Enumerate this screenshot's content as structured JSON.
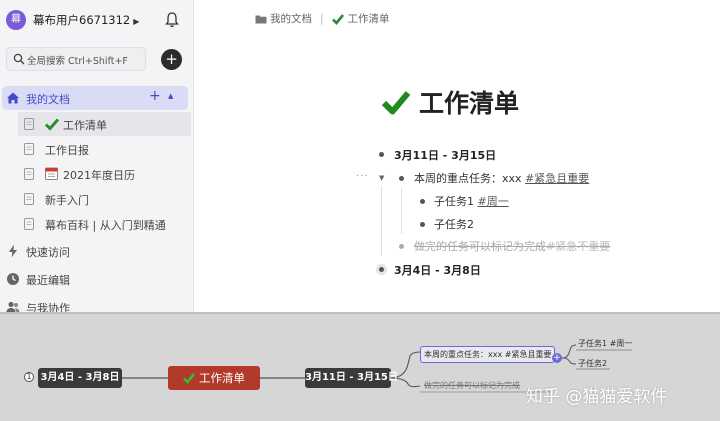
{
  "user": {
    "avatar_text": "幕",
    "name": "幕布用户6671312"
  },
  "search": {
    "placeholder": "全局搜索 Ctrl+Shift+F"
  },
  "sidebar": {
    "my_docs": "我的文档",
    "docs": [
      {
        "label": "工作清单",
        "icon": "check-emoji"
      },
      {
        "label": "工作日报",
        "icon": "doc"
      },
      {
        "label": "2021年度日历",
        "icon": "calendar-emoji"
      },
      {
        "label": "新手入门",
        "icon": "doc"
      },
      {
        "label": "幕布百科 | 从入门到精通",
        "icon": "doc"
      }
    ],
    "quick_access": "快速访问",
    "recent": "最近编辑",
    "shared": "与我协作"
  },
  "breadcrumb": {
    "folder": "我的文档",
    "current": "工作清单"
  },
  "document": {
    "title": "工作清单",
    "outline": {
      "week1": "3月11日 - 3月15日",
      "focus_prefix": "本周的重点任务：xxx ",
      "focus_tag": "#紧急且重要",
      "sub1_text": "子任务1 ",
      "sub1_tag": "#周一",
      "sub2_text": "子任务2",
      "done_text": "做完的任务可以标记为完成",
      "done_tag": "#紧急不重要",
      "week2": "3月4日 - 3月8日"
    }
  },
  "mindmap": {
    "left_node": "3月4日 - 3月8日",
    "root": "工作清单",
    "right_node": "3月11日 - 3月15日",
    "branch1": "本周的重点任务：xxx #紧急且重要",
    "branch2": "做完的任务可以标记为完成",
    "leaf1": "子任务1 #周一",
    "leaf2": "子任务2",
    "collapse_symbol": "1",
    "expand_symbol": "+"
  },
  "watermark": "知乎 @猫猫爱软件",
  "colors": {
    "accent": "#4548c9",
    "sidebar_bg": "#f4f4f6",
    "active_bg": "#dadcf6",
    "root_node": "#b23a2a",
    "dark_node": "#3a3a3a",
    "mindmap_bg": "#d6d6d6",
    "check_green": "#2e8b2e"
  }
}
